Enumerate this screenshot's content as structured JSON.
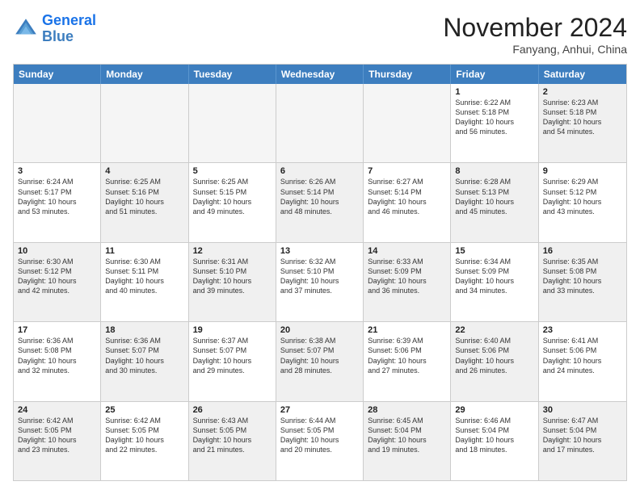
{
  "header": {
    "logo_line1": "General",
    "logo_line2": "Blue",
    "month": "November 2024",
    "location": "Fanyang, Anhui, China"
  },
  "day_headers": [
    "Sunday",
    "Monday",
    "Tuesday",
    "Wednesday",
    "Thursday",
    "Friday",
    "Saturday"
  ],
  "rows": [
    [
      {
        "day": "",
        "info": "",
        "empty": true
      },
      {
        "day": "",
        "info": "",
        "empty": true
      },
      {
        "day": "",
        "info": "",
        "empty": true
      },
      {
        "day": "",
        "info": "",
        "empty": true
      },
      {
        "day": "",
        "info": "",
        "empty": true
      },
      {
        "day": "1",
        "info": "Sunrise: 6:22 AM\nSunset: 5:18 PM\nDaylight: 10 hours\nand 56 minutes.",
        "empty": false
      },
      {
        "day": "2",
        "info": "Sunrise: 6:23 AM\nSunset: 5:18 PM\nDaylight: 10 hours\nand 54 minutes.",
        "empty": false,
        "shaded": true
      }
    ],
    [
      {
        "day": "3",
        "info": "Sunrise: 6:24 AM\nSunset: 5:17 PM\nDaylight: 10 hours\nand 53 minutes.",
        "empty": false
      },
      {
        "day": "4",
        "info": "Sunrise: 6:25 AM\nSunset: 5:16 PM\nDaylight: 10 hours\nand 51 minutes.",
        "empty": false,
        "shaded": true
      },
      {
        "day": "5",
        "info": "Sunrise: 6:25 AM\nSunset: 5:15 PM\nDaylight: 10 hours\nand 49 minutes.",
        "empty": false
      },
      {
        "day": "6",
        "info": "Sunrise: 6:26 AM\nSunset: 5:14 PM\nDaylight: 10 hours\nand 48 minutes.",
        "empty": false,
        "shaded": true
      },
      {
        "day": "7",
        "info": "Sunrise: 6:27 AM\nSunset: 5:14 PM\nDaylight: 10 hours\nand 46 minutes.",
        "empty": false
      },
      {
        "day": "8",
        "info": "Sunrise: 6:28 AM\nSunset: 5:13 PM\nDaylight: 10 hours\nand 45 minutes.",
        "empty": false,
        "shaded": true
      },
      {
        "day": "9",
        "info": "Sunrise: 6:29 AM\nSunset: 5:12 PM\nDaylight: 10 hours\nand 43 minutes.",
        "empty": false
      }
    ],
    [
      {
        "day": "10",
        "info": "Sunrise: 6:30 AM\nSunset: 5:12 PM\nDaylight: 10 hours\nand 42 minutes.",
        "empty": false,
        "shaded": true
      },
      {
        "day": "11",
        "info": "Sunrise: 6:30 AM\nSunset: 5:11 PM\nDaylight: 10 hours\nand 40 minutes.",
        "empty": false
      },
      {
        "day": "12",
        "info": "Sunrise: 6:31 AM\nSunset: 5:10 PM\nDaylight: 10 hours\nand 39 minutes.",
        "empty": false,
        "shaded": true
      },
      {
        "day": "13",
        "info": "Sunrise: 6:32 AM\nSunset: 5:10 PM\nDaylight: 10 hours\nand 37 minutes.",
        "empty": false
      },
      {
        "day": "14",
        "info": "Sunrise: 6:33 AM\nSunset: 5:09 PM\nDaylight: 10 hours\nand 36 minutes.",
        "empty": false,
        "shaded": true
      },
      {
        "day": "15",
        "info": "Sunrise: 6:34 AM\nSunset: 5:09 PM\nDaylight: 10 hours\nand 34 minutes.",
        "empty": false
      },
      {
        "day": "16",
        "info": "Sunrise: 6:35 AM\nSunset: 5:08 PM\nDaylight: 10 hours\nand 33 minutes.",
        "empty": false,
        "shaded": true
      }
    ],
    [
      {
        "day": "17",
        "info": "Sunrise: 6:36 AM\nSunset: 5:08 PM\nDaylight: 10 hours\nand 32 minutes.",
        "empty": false
      },
      {
        "day": "18",
        "info": "Sunrise: 6:36 AM\nSunset: 5:07 PM\nDaylight: 10 hours\nand 30 minutes.",
        "empty": false,
        "shaded": true
      },
      {
        "day": "19",
        "info": "Sunrise: 6:37 AM\nSunset: 5:07 PM\nDaylight: 10 hours\nand 29 minutes.",
        "empty": false
      },
      {
        "day": "20",
        "info": "Sunrise: 6:38 AM\nSunset: 5:07 PM\nDaylight: 10 hours\nand 28 minutes.",
        "empty": false,
        "shaded": true
      },
      {
        "day": "21",
        "info": "Sunrise: 6:39 AM\nSunset: 5:06 PM\nDaylight: 10 hours\nand 27 minutes.",
        "empty": false
      },
      {
        "day": "22",
        "info": "Sunrise: 6:40 AM\nSunset: 5:06 PM\nDaylight: 10 hours\nand 26 minutes.",
        "empty": false,
        "shaded": true
      },
      {
        "day": "23",
        "info": "Sunrise: 6:41 AM\nSunset: 5:06 PM\nDaylight: 10 hours\nand 24 minutes.",
        "empty": false
      }
    ],
    [
      {
        "day": "24",
        "info": "Sunrise: 6:42 AM\nSunset: 5:05 PM\nDaylight: 10 hours\nand 23 minutes.",
        "empty": false,
        "shaded": true
      },
      {
        "day": "25",
        "info": "Sunrise: 6:42 AM\nSunset: 5:05 PM\nDaylight: 10 hours\nand 22 minutes.",
        "empty": false
      },
      {
        "day": "26",
        "info": "Sunrise: 6:43 AM\nSunset: 5:05 PM\nDaylight: 10 hours\nand 21 minutes.",
        "empty": false,
        "shaded": true
      },
      {
        "day": "27",
        "info": "Sunrise: 6:44 AM\nSunset: 5:05 PM\nDaylight: 10 hours\nand 20 minutes.",
        "empty": false
      },
      {
        "day": "28",
        "info": "Sunrise: 6:45 AM\nSunset: 5:04 PM\nDaylight: 10 hours\nand 19 minutes.",
        "empty": false,
        "shaded": true
      },
      {
        "day": "29",
        "info": "Sunrise: 6:46 AM\nSunset: 5:04 PM\nDaylight: 10 hours\nand 18 minutes.",
        "empty": false
      },
      {
        "day": "30",
        "info": "Sunrise: 6:47 AM\nSunset: 5:04 PM\nDaylight: 10 hours\nand 17 minutes.",
        "empty": false,
        "shaded": true
      }
    ]
  ]
}
